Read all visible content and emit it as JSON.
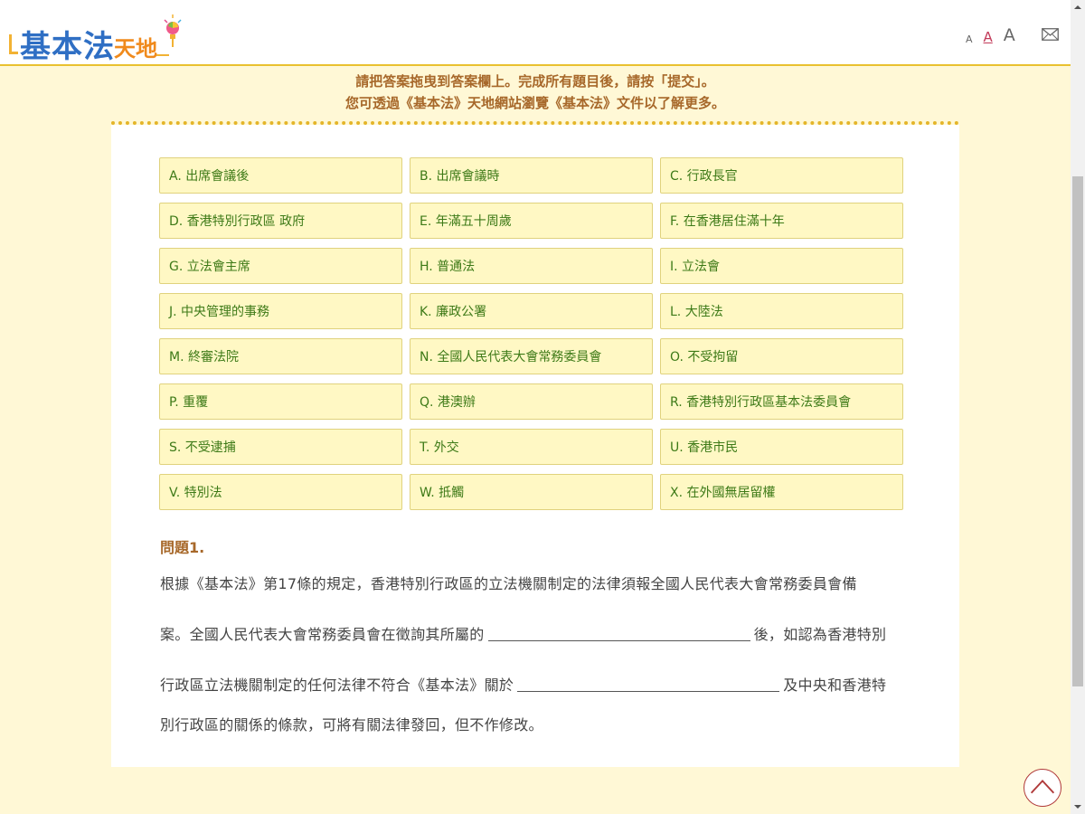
{
  "header": {
    "logo_main": "基本法",
    "logo_sub": "天地",
    "font_small": "A",
    "font_medium": "A",
    "font_large": "A",
    "mail_icon": "mail-icon"
  },
  "instructions": {
    "line1": "請把答案拖曳到答案欄上。完成所有題目後，請按「提交」。",
    "line2": "您可透過《基本法》天地網站瀏覽《基本法》文件以了解更多。"
  },
  "options": [
    "A. 出席會議後",
    "B. 出席會議時",
    "C. 行政長官",
    "D. 香港特別行政區 政府",
    "E. 年滿五十周歲",
    "F. 在香港居住滿十年",
    "G. 立法會主席",
    "H. 普通法",
    "I. 立法會",
    "J. 中央管理的事務",
    "K. 廉政公署",
    "L. 大陸法",
    "M. 終審法院",
    "N. 全國人民代表大會常務委員會",
    "O. 不受拘留",
    "P. 重覆",
    "Q. 港澳辦",
    "R. 香港特別行政區基本法委員會",
    "S. 不受逮捕",
    "T. 外交",
    "U. 香港市民",
    "V. 特別法",
    "W. 抵觸",
    "X. 在外國無居留權"
  ],
  "question": {
    "title": "問題1.",
    "line1": "根據《基本法》第17條的規定，香港特別行政區的立法機關制定的法律須報全國人民代表大會常務委員會備",
    "line2_a": "案。全國人民代表大會常務委員會在徵詢其所屬的",
    "line2_b": "後，如認為香港特別",
    "line3_a": "行政區立法機關制定的任何法律不符合《基本法》關於",
    "line3_b": "及中央和香港特",
    "line4": "別行政區的關係的條款，可將有關法律發回，但不作修改。"
  },
  "colors": {
    "page_bg": "#fff8d6",
    "option_bg": "#fff8c4",
    "option_text": "#3d7a17",
    "accent_brown": "#a7682a",
    "divider_gold": "#e4b529"
  }
}
